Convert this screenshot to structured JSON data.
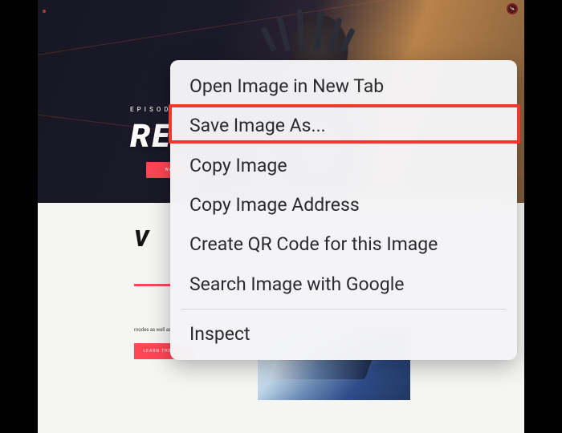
{
  "hero": {
    "episode_label": "EPISODE",
    "title_fragment": "RE",
    "cta_label": "WAT"
  },
  "section": {
    "title_fragment": "V",
    "article_body": "modes as well as Deathmatch and Spike Rush.",
    "article_cta": "LEARN THE GAME"
  },
  "badge": {
    "name": "valorant-logo-icon"
  },
  "context_menu": {
    "items": [
      {
        "id": "open-new-tab",
        "label": "Open Image in New Tab"
      },
      {
        "id": "save-as",
        "label": "Save Image As..."
      },
      {
        "id": "copy-image",
        "label": "Copy Image"
      },
      {
        "id": "copy-address",
        "label": "Copy Image Address"
      },
      {
        "id": "qr-code",
        "label": "Create QR Code for this Image"
      },
      {
        "id": "search-google",
        "label": "Search Image with Google"
      }
    ],
    "inspect_label": "Inspect"
  },
  "annotation": {
    "highlighted_item_id": "save-as"
  }
}
